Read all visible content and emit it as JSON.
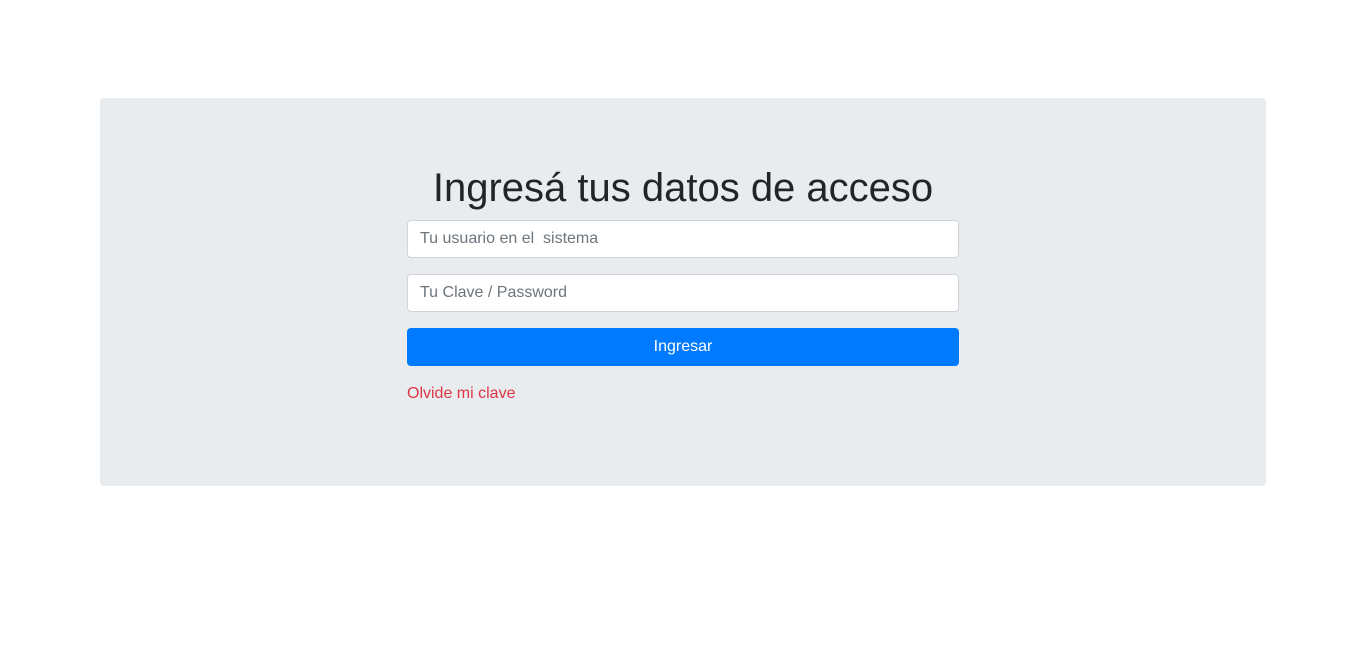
{
  "login": {
    "title": "Ingresá tus datos de acceso",
    "username_placeholder": "Tu usuario en el  sistema",
    "username_value": "",
    "password_placeholder": "Tu Clave / Password",
    "password_value": "",
    "submit_label": "Ingresar",
    "forgot_link": "Olvide mi clave"
  },
  "colors": {
    "primary": "#007bff",
    "danger": "#dc3545",
    "panel": "#e9ecef"
  }
}
